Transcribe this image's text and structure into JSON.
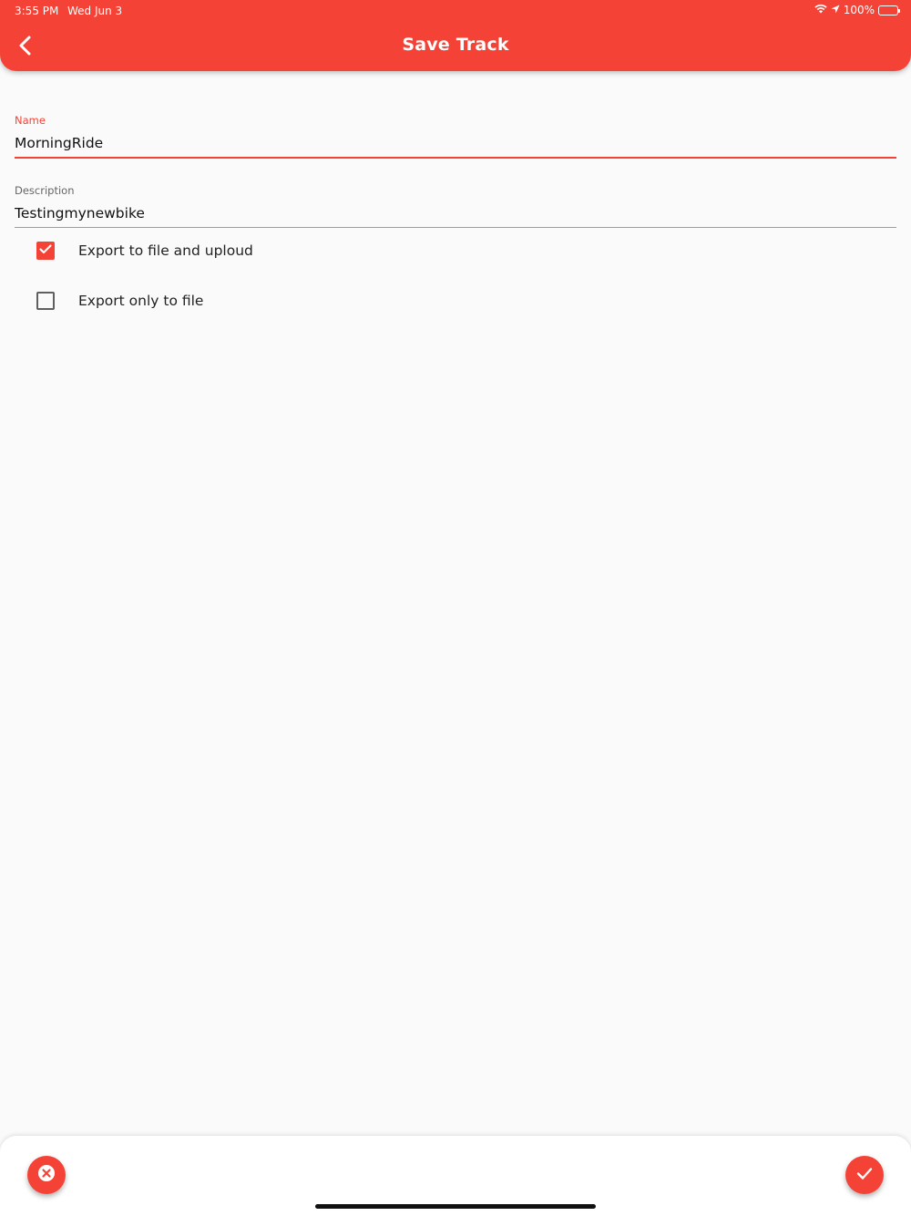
{
  "status_bar": {
    "time": "3:55 PM",
    "date": "Wed Jun 3",
    "battery": "100%"
  },
  "app_bar": {
    "title": "Save Track",
    "back_icon": "chevron-left-icon",
    "color": "#f44336"
  },
  "form": {
    "name": {
      "label": "Name",
      "value": "MorningRide"
    },
    "description": {
      "label": "Description",
      "value": "Testingmynewbike"
    },
    "options": [
      {
        "label": "Export to file and uploud",
        "checked": true
      },
      {
        "label": "Export only to file",
        "checked": false
      }
    ]
  },
  "bottom_bar": {
    "cancel_icon": "close-circle-icon",
    "confirm_icon": "check-icon"
  }
}
